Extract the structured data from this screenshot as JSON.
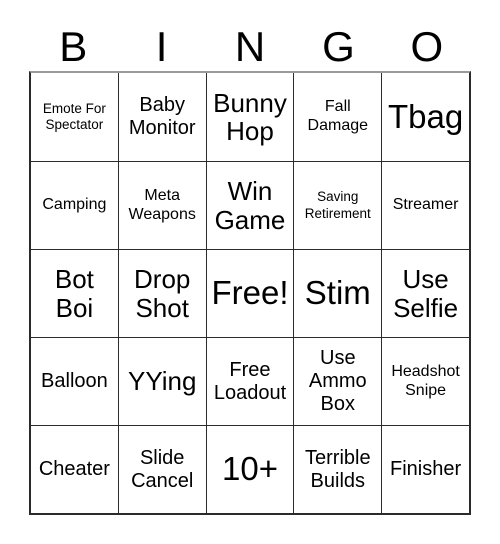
{
  "card": {
    "type": "bingo-card",
    "header_letters": [
      "B",
      "I",
      "N",
      "G",
      "O"
    ],
    "columns": 5,
    "rows": 5,
    "colors": {
      "background": "#ffffff",
      "text": "#000000",
      "grid_line": "#2b2b2b",
      "top_border": "#9a9a9a"
    },
    "cells": [
      [
        {
          "text": "Emote For Spectator",
          "size": "xs"
        },
        {
          "text": "Baby Monitor",
          "size": "m"
        },
        {
          "text": "Bunny Hop",
          "size": "l"
        },
        {
          "text": "Fall Damage",
          "size": "s"
        },
        {
          "text": "Tbag",
          "size": "xl"
        }
      ],
      [
        {
          "text": "Camping",
          "size": "s"
        },
        {
          "text": "Meta Weapons",
          "size": "s"
        },
        {
          "text": "Win Game",
          "size": "l"
        },
        {
          "text": "Saving Retirement",
          "size": "xs"
        },
        {
          "text": "Streamer",
          "size": "s"
        }
      ],
      [
        {
          "text": "Bot Boi",
          "size": "l"
        },
        {
          "text": "Drop Shot",
          "size": "l"
        },
        {
          "text": "Free!",
          "size": "xl"
        },
        {
          "text": "Stim",
          "size": "xl"
        },
        {
          "text": "Use Selfie",
          "size": "l"
        }
      ],
      [
        {
          "text": "Balloon",
          "size": "m"
        },
        {
          "text": "YYing",
          "size": "l"
        },
        {
          "text": "Free Loadout",
          "size": "m"
        },
        {
          "text": "Use Ammo Box",
          "size": "m"
        },
        {
          "text": "Headshot Snipe",
          "size": "s"
        }
      ],
      [
        {
          "text": "Cheater",
          "size": "m"
        },
        {
          "text": "Slide Cancel",
          "size": "m"
        },
        {
          "text": "10+",
          "size": "xl"
        },
        {
          "text": "Terrible Builds",
          "size": "m"
        },
        {
          "text": "Finisher",
          "size": "m"
        }
      ]
    ]
  }
}
